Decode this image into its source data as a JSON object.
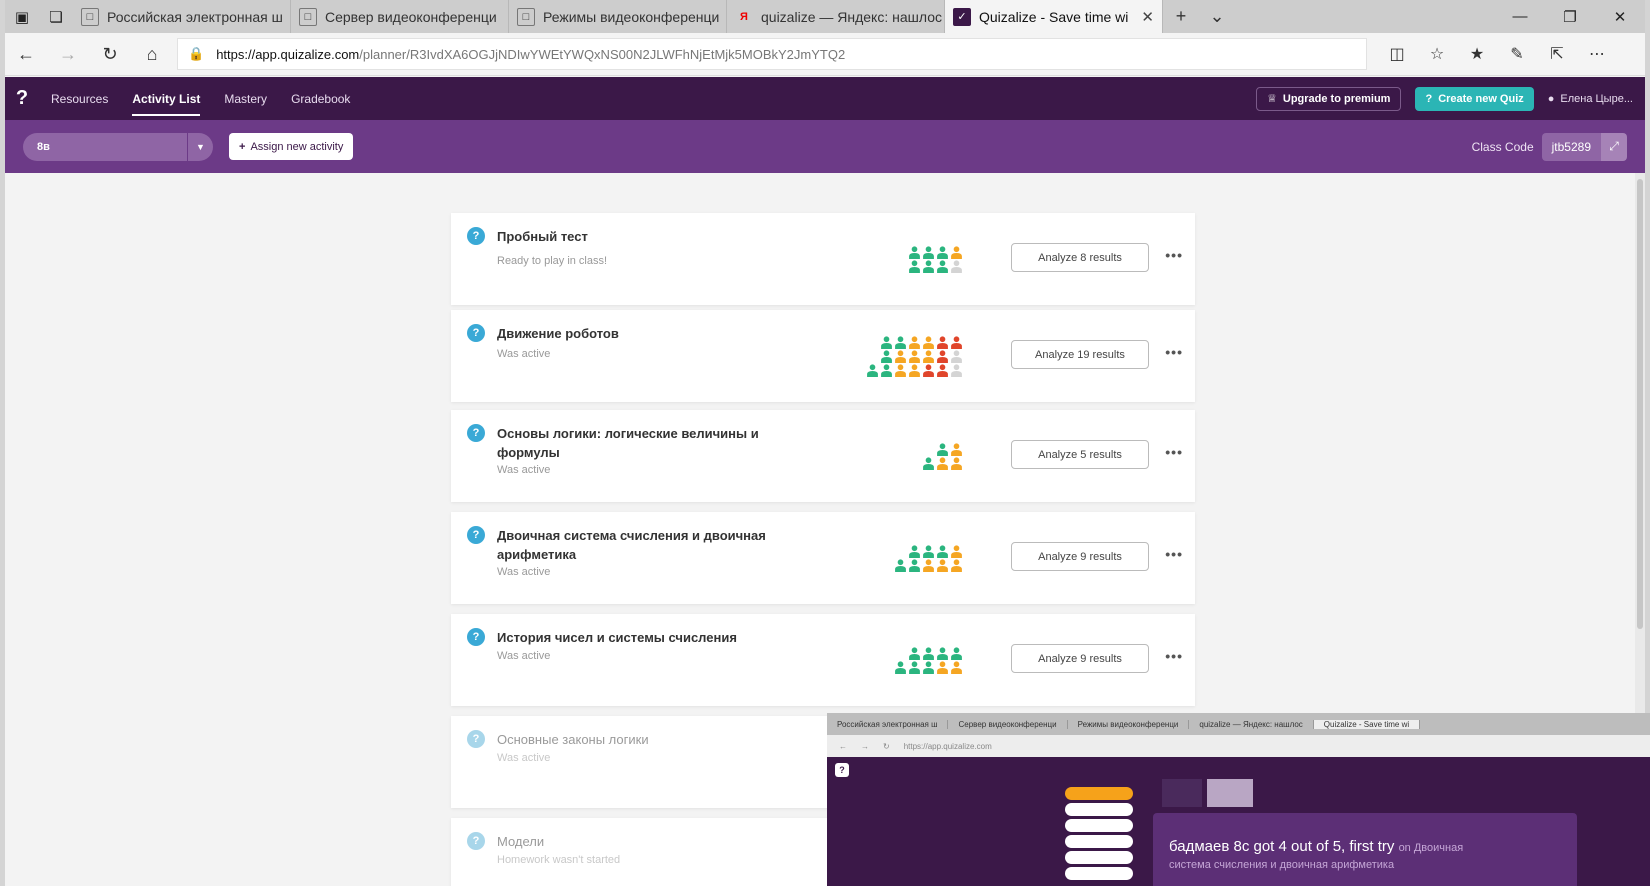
{
  "browser": {
    "tabs": [
      {
        "label": "Российская электронная ш"
      },
      {
        "label": "Сервер видеоконференци"
      },
      {
        "label": "Режимы видеоконференци"
      },
      {
        "label": "quizalize — Яндекс: нашлос"
      },
      {
        "label": "Quizalize - Save time wi",
        "active": true
      }
    ],
    "new_tab": "+",
    "url_host": "https://app.quizalize.com",
    "url_path": "/planner/R3IvdXA6OGJjNDIwYWEtYWQxNS00N2JLWFhNjEtMjk5MOBkY2JmYTQ2"
  },
  "app": {
    "nav": [
      {
        "label": "Resources"
      },
      {
        "label": "Activity List",
        "active": true
      },
      {
        "label": "Mastery"
      },
      {
        "label": "Gradebook"
      }
    ],
    "upgrade_label": "Upgrade to premium",
    "create_label": "Create new Quiz",
    "user_name": "Елена Цыре...",
    "class_selected": "8в",
    "assign_label": "Assign new activity",
    "class_code_label": "Class Code",
    "class_code": "jtb5289"
  },
  "activities": [
    {
      "title": "Пробный тест",
      "status": "Ready to play in class!",
      "analyze": "Analyze 8 results",
      "results": [
        [
          "g",
          "g",
          "g",
          "o"
        ],
        [
          "g",
          "g",
          "g",
          "x"
        ]
      ]
    },
    {
      "title": "Движение роботов",
      "status": "Was active",
      "analyze": "Analyze 19 results",
      "results": [
        [
          "g",
          "g",
          "o",
          "o",
          "r",
          "r"
        ],
        [
          "g",
          "o",
          "o",
          "o",
          "r",
          "x"
        ],
        [
          "g",
          "g",
          "o",
          "o",
          "r",
          "r",
          "x"
        ]
      ]
    },
    {
      "title": "Основы логики: логические величины и формулы",
      "status": "Was active",
      "analyze": "Analyze 5 results",
      "results": [
        [
          "g",
          "o"
        ],
        [
          "g",
          "o",
          "o"
        ]
      ]
    },
    {
      "title": "Двоичная система счисления и двоичная арифметика",
      "status": "Was active",
      "analyze": "Analyze 9 results",
      "results": [
        [
          "g",
          "g",
          "g",
          "o"
        ],
        [
          "g",
          "g",
          "o",
          "o",
          "o"
        ]
      ]
    },
    {
      "title": "История чисел и системы счисления",
      "status": "Was active",
      "analyze": "Analyze 9 results",
      "results": [
        [
          "g",
          "g",
          "g",
          "g"
        ],
        [
          "g",
          "g",
          "g",
          "o",
          "o"
        ]
      ]
    },
    {
      "title": "Основные законы логики",
      "status": "Was active"
    },
    {
      "title": "Модели",
      "status": "Homework wasn't started"
    }
  ],
  "colors": {
    "g": "#2bb57f",
    "o": "#f5a623",
    "r": "#e0452b",
    "x": "#d4d4d4"
  },
  "overlay": {
    "message": "бадмаев 8с got 4 out of 5, first try",
    "on_label": "on Двоичная",
    "message2": "система счисления и двоичная арифметика"
  }
}
